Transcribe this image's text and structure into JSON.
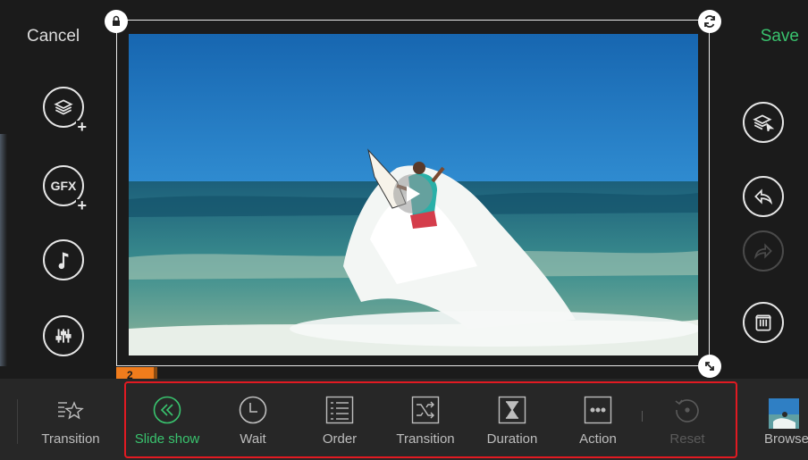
{
  "header": {
    "cancel_label": "Cancel",
    "save_label": "Save"
  },
  "left_panel": [
    {
      "name": "add-layer",
      "icon": "layers-plus-icon"
    },
    {
      "name": "add-gfx",
      "icon": "gfx-plus-icon",
      "icon_text": "GFX"
    },
    {
      "name": "music",
      "icon": "music-note-icon"
    },
    {
      "name": "mixer",
      "icon": "mixer-icon"
    }
  ],
  "right_panel": [
    {
      "name": "select-layer",
      "icon": "layers-cursor-icon"
    },
    {
      "name": "undo",
      "icon": "undo-icon"
    },
    {
      "name": "redo",
      "icon": "redo-icon",
      "enabled": false
    },
    {
      "name": "delete",
      "icon": "trash-icon"
    }
  ],
  "timeline": {
    "clip_number": "2"
  },
  "toolbar": {
    "items": [
      {
        "label": "Transition",
        "icon": "star-transition-icon"
      },
      {
        "label": "Slide show",
        "icon": "double-chevron-left-icon",
        "active": true
      },
      {
        "label": "Wait",
        "icon": "clock-icon"
      },
      {
        "label": "Order",
        "icon": "list-icon"
      },
      {
        "label": "Transition",
        "icon": "shuffle-icon"
      },
      {
        "label": "Duration",
        "icon": "hourglass-icon"
      },
      {
        "label": "Action",
        "icon": "ellipsis-icon"
      },
      {
        "label": "Reset",
        "icon": "reset-icon",
        "enabled": false
      },
      {
        "label": "Browse",
        "icon": "thumbnail-icon"
      }
    ]
  },
  "colors": {
    "accent": "#39c36e",
    "highlight": "#e11a22",
    "background": "#1b1b1b",
    "toolbar": "#272727",
    "timeline_marker": "#f07c1c"
  }
}
